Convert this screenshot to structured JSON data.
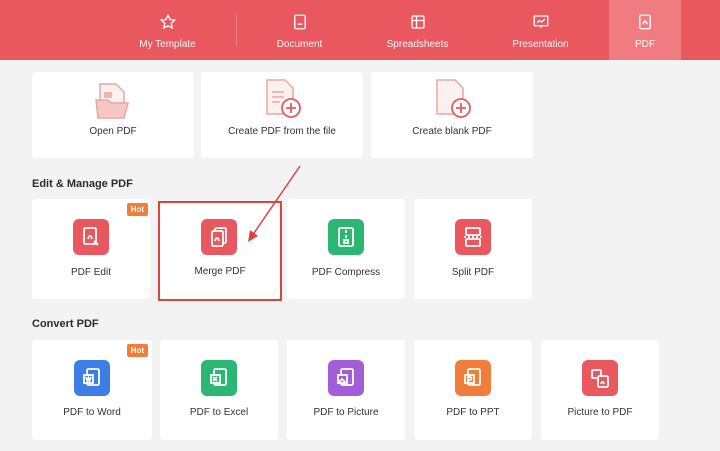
{
  "tabs": [
    {
      "label": "My Template",
      "icon": "star-icon"
    },
    {
      "label": "Document",
      "icon": "document-icon"
    },
    {
      "label": "Spreadsheets",
      "icon": "spreadsheet-icon"
    },
    {
      "label": "Presentation",
      "icon": "presentation-icon"
    },
    {
      "label": "PDF",
      "icon": "pdf-icon",
      "active": true
    }
  ],
  "quick_actions": [
    {
      "label": "Open PDF",
      "icon": "open-folder-icon"
    },
    {
      "label": "Create PDF from the file",
      "icon": "create-from-file-icon"
    },
    {
      "label": "Create blank PDF",
      "icon": "create-blank-icon"
    }
  ],
  "edit_manage": {
    "title": "Edit & Manage PDF",
    "items": [
      {
        "label": "PDF Edit",
        "icon": "pdf-edit-icon",
        "color": "#e8585e",
        "badge": "Hot"
      },
      {
        "label": "Merge PDF",
        "icon": "merge-pdf-icon",
        "color": "#e8585e"
      },
      {
        "label": "PDF Compress",
        "icon": "compress-icon",
        "color": "#2bb673"
      },
      {
        "label": "Split PDF",
        "icon": "split-icon",
        "color": "#e8585e"
      }
    ]
  },
  "convert": {
    "title": "Convert PDF",
    "items": [
      {
        "label": "PDF to Word",
        "icon": "word-icon",
        "color": "#3d7ee6",
        "badge": "Hot"
      },
      {
        "label": "PDF to Excel",
        "icon": "excel-icon",
        "color": "#2bb673"
      },
      {
        "label": "PDF to Picture",
        "icon": "picture-icon",
        "color": "#a25ed6"
      },
      {
        "label": "PDF to PPT",
        "icon": "ppt-icon",
        "color": "#f07d3a"
      },
      {
        "label": "Picture to PDF",
        "icon": "picture-to-pdf-icon",
        "color": "#e8585e"
      }
    ]
  }
}
